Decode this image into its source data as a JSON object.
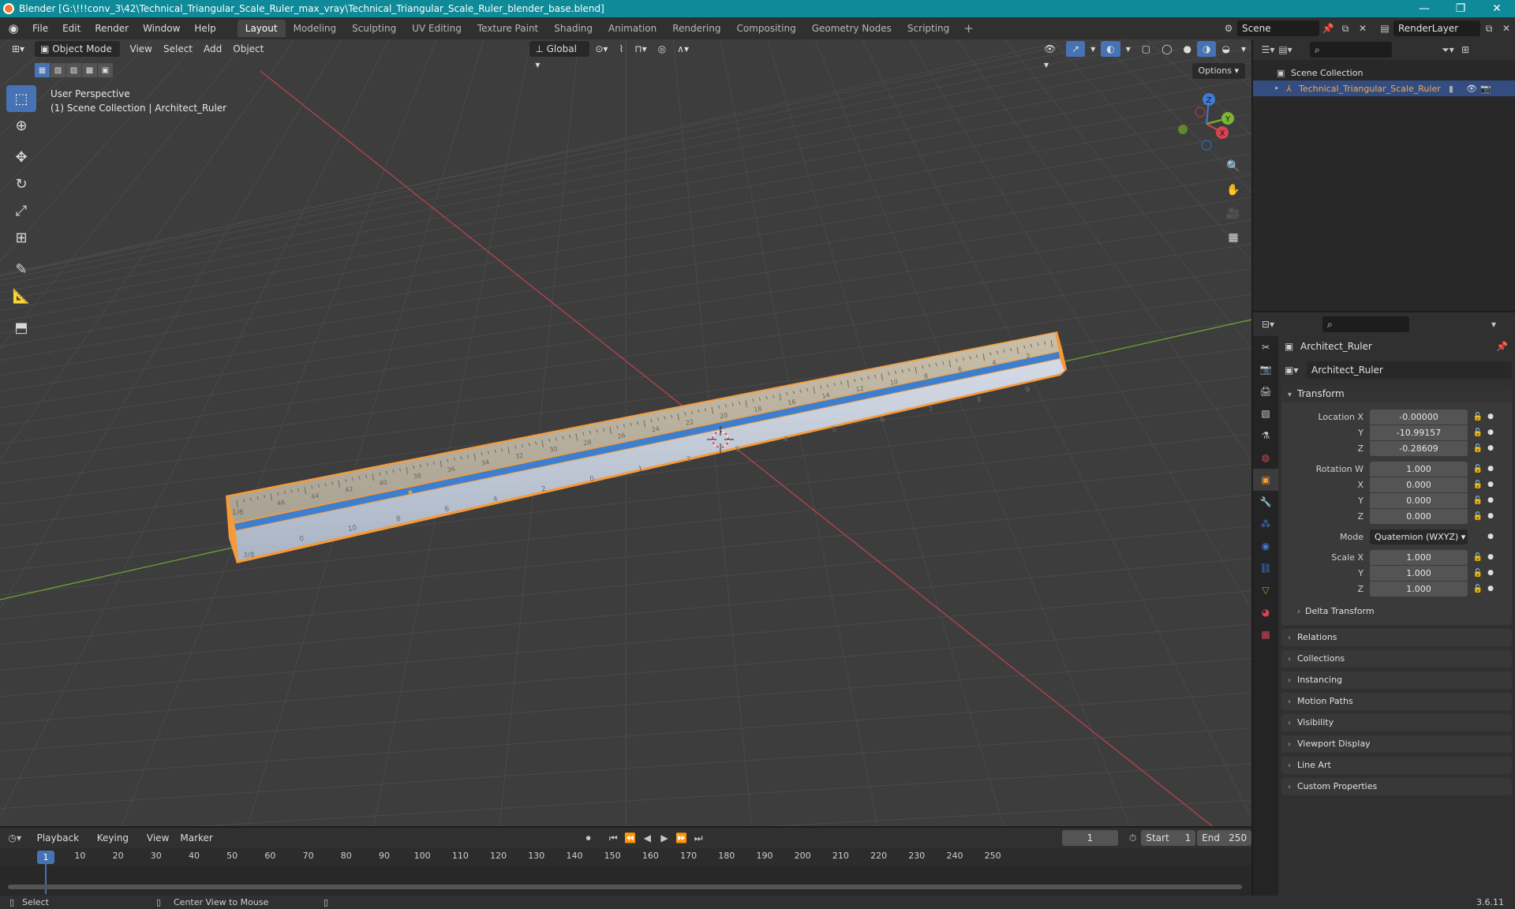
{
  "window": {
    "title": "Blender [G:\\!!!conv_3\\42\\Technical_Triangular_Scale_Ruler_max_vray\\Technical_Triangular_Scale_Ruler_blender_base.blend]",
    "minimize": "—",
    "maximize": "❐",
    "close": "✕"
  },
  "menubar": {
    "items": [
      "File",
      "Edit",
      "Render",
      "Window",
      "Help"
    ],
    "workspaces": [
      "Layout",
      "Modeling",
      "Sculpting",
      "UV Editing",
      "Texture Paint",
      "Shading",
      "Animation",
      "Rendering",
      "Compositing",
      "Geometry Nodes",
      "Scripting"
    ],
    "active_workspace": 0,
    "add_workspace": "+",
    "scene": "Scene",
    "view_layer": "RenderLayer"
  },
  "viewport_header": {
    "mode": "Object Mode",
    "menus": [
      "View",
      "Select",
      "Add",
      "Object"
    ],
    "orientation": "Global",
    "options": "Options"
  },
  "viewport": {
    "perspective": "User Perspective",
    "collection_info": "(1) Scene Collection | Architect_Ruler",
    "gizmo_axes": {
      "x": "X",
      "y": "Y",
      "z": "Z"
    },
    "colors": {
      "x_axis": "#d9434f",
      "y_axis": "#7cb534",
      "z_axis": "#3d7bd6",
      "selection": "#f59a3a"
    }
  },
  "ruler": {
    "top_scale_labels": [
      "46",
      "44",
      "42",
      "40",
      "38",
      "36",
      "34",
      "32",
      "30",
      "28",
      "26",
      "24",
      "22",
      "20",
      "18",
      "16",
      "14",
      "12",
      "10",
      "8",
      "6",
      "4",
      "2"
    ],
    "bottom_scale_labels": [
      "0",
      "10",
      "8",
      "6",
      "4",
      "2",
      "0",
      "1",
      "2",
      "3",
      "4",
      "5",
      "6",
      "7",
      "8",
      "9"
    ],
    "left_fraction_top": "1/8",
    "left_fraction_bottom": "3/8"
  },
  "outliner": {
    "root": "Scene Collection",
    "object": "Technical_Triangular_Scale_Ruler"
  },
  "properties": {
    "object_name": "Architect_Ruler",
    "data_name": "Architect_Ruler",
    "transform_title": "Transform",
    "location": {
      "label": "Location X",
      "x": "-0.00000",
      "y": "-10.99157",
      "z": "-0.28609"
    },
    "rotation": {
      "label": "Rotation W",
      "w": "1.000",
      "x": "0.000",
      "y": "0.000",
      "z": "0.000"
    },
    "mode": {
      "label": "Mode",
      "value": "Quaternion (WXYZ)"
    },
    "scale": {
      "label": "Scale X",
      "x": "1.000",
      "y": "1.000",
      "z": "1.000"
    },
    "axis_labels": {
      "y": "Y",
      "z": "Z",
      "x": "X"
    },
    "delta": "Delta Transform",
    "panels": [
      "Relations",
      "Collections",
      "Instancing",
      "Motion Paths",
      "Visibility",
      "Viewport Display",
      "Line Art",
      "Custom Properties"
    ]
  },
  "timeline": {
    "menus": [
      "Playback",
      "Keying",
      "View",
      "Marker"
    ],
    "current_frame": "1",
    "start_label": "Start",
    "start": "1",
    "end_label": "End",
    "end": "250",
    "ticks": [
      "10",
      "20",
      "30",
      "40",
      "50",
      "60",
      "70",
      "80",
      "90",
      "100",
      "110",
      "120",
      "130",
      "140",
      "150",
      "160",
      "170",
      "180",
      "190",
      "200",
      "210",
      "220",
      "230",
      "240",
      "250"
    ]
  },
  "statusbar": {
    "select": "Select",
    "center_view": "Center View to Mouse",
    "version": "3.6.11"
  }
}
